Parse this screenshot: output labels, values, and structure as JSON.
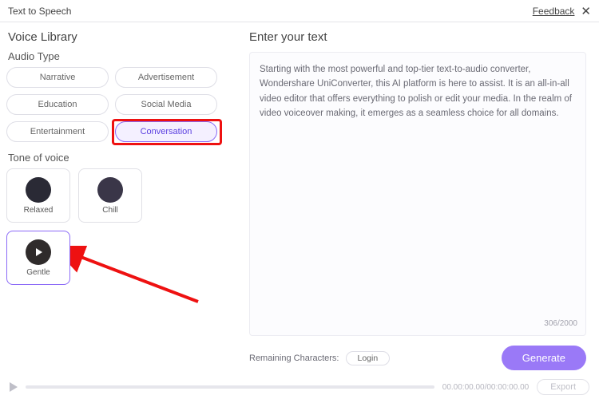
{
  "toolbar": {
    "title": "Text to Speech",
    "feedback": "Feedback"
  },
  "sidebar": {
    "library_title": "Voice Library",
    "audio_type_label": "Audio Type",
    "chips": [
      "Narrative",
      "Advertisement",
      "Education",
      "Social Media",
      "Entertainment",
      "Conversation"
    ],
    "selected_chip_index": 5,
    "tone_label": "Tone of voice",
    "tones": [
      {
        "name": "Relaxed"
      },
      {
        "name": "Chill"
      },
      {
        "name": "Gentle"
      }
    ],
    "selected_tone_index": 2
  },
  "content": {
    "enter_title": "Enter your text",
    "text": "Starting with the most powerful and top-tier text-to-audio converter, Wondershare UniConverter, this AI platform is here to assist. It is an all-in-all video editor that offers everything to polish or edit your media. In the realm of video voiceover making, it emerges as a seamless choice for all domains.",
    "counter": "306/2000",
    "remaining_label": "Remaining Characters:",
    "login_label": "Login",
    "generate_label": "Generate"
  },
  "bottombar": {
    "time": "00.00:00.00/00:00:00.00",
    "export_label": "Export"
  },
  "colors": {
    "accent": "#9a79f7",
    "highlight": "#e11"
  }
}
